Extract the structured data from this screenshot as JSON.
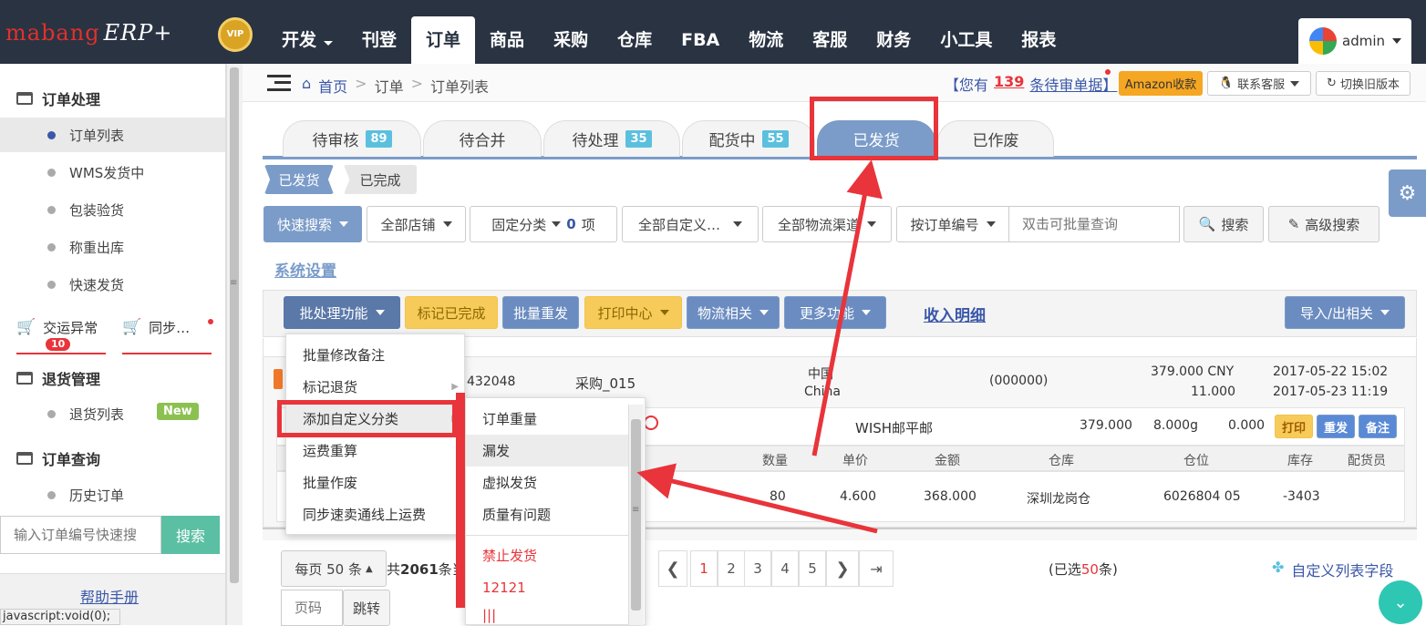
{
  "brand": {
    "logo": "mabang",
    "logo2": "ERP+",
    "vip": "VIP"
  },
  "nav": [
    "开发",
    "刊登",
    "订单",
    "商品",
    "采购",
    "仓库",
    "FBA",
    "物流",
    "客服",
    "财务",
    "小工具",
    "报表"
  ],
  "nav_dropdown": "开发",
  "nav_active": "订单",
  "user": {
    "name": "admin"
  },
  "sidebar": {
    "order_handling": "订单处理",
    "items": [
      "订单列表",
      "WMS发货中",
      "包装验货",
      "称重出库",
      "快速发货"
    ],
    "exception": "交运异常",
    "exception_badge": "10",
    "sync": "同步…",
    "returns": "退货管理",
    "return_list": "退货列表",
    "new_badge": "New",
    "query": "订单查询",
    "history": "历史订单",
    "search_placeholder": "输入订单编号快速搜",
    "search_button": "搜索",
    "help": "帮助手册",
    "status": "javascript:void(0);"
  },
  "breadcrumb": {
    "home": "首页",
    "b1": "订单",
    "b2": "订单列表"
  },
  "pending": {
    "pre": "【您有",
    "count": "139",
    "post": "条待审单据】"
  },
  "header_buttons": {
    "amazon": "Amazon收款",
    "contact": "联系客服",
    "switch": "切换旧版本"
  },
  "tabs": [
    {
      "label": "待审核",
      "count": "89"
    },
    {
      "label": "待合并",
      "count": ""
    },
    {
      "label": "待处理",
      "count": "35"
    },
    {
      "label": "配货中",
      "count": "55"
    },
    {
      "label": "已发货",
      "count": ""
    },
    {
      "label": "已作废",
      "count": ""
    }
  ],
  "subtabs": [
    "已发货",
    "已完成"
  ],
  "filters": {
    "quick": "快速搜索",
    "store": "全部店铺",
    "fixed": "固定分类",
    "fixed_count": "0",
    "fixed_unit": "项",
    "custom": "全部自定义…",
    "logistics": "全部物流渠道",
    "by_order": "按订单编号",
    "batch_placeholder": "双击可批量查询",
    "search": "搜索",
    "adv": "高级搜索"
  },
  "system_settings": "系统设置",
  "toolbar": {
    "batch": "批处理功能",
    "mark_done": "标记已完成",
    "batch_resend": "批量重发",
    "print": "打印中心",
    "logistics": "物流相关",
    "more": "更多功能",
    "income": "收入明细",
    "import": "导入/出相关"
  },
  "batch_menu": [
    "批量修改备注",
    "标记退货",
    "添加自定义分类",
    "运费重算",
    "批量作废",
    "同步速卖通线上运费"
  ],
  "sub_menu": [
    "订单重量",
    "漏发",
    "虚拟发货",
    "质量有问题"
  ],
  "sub_menu_red": [
    "禁止发货",
    "12121",
    "|||"
  ],
  "order": {
    "num_frag": "432048",
    "sku": "采购_015",
    "country": "中国",
    "country_en": "China",
    "phone": "(000000)",
    "amount": "379.000 CNY",
    "amount2": "11.000",
    "date1": "2017-05-22 15:02",
    "date2": "2017-05-23 11:19",
    "channel": "WISH邮平邮",
    "price": "379.000",
    "weight": "8.000g",
    "fee": "0.000",
    "act_print": "打印",
    "act_resend": "重发",
    "act_note": "备注"
  },
  "detail_headers": [
    "数量",
    "单价",
    "金额",
    "仓库",
    "仓位",
    "库存",
    "配货员"
  ],
  "detail_row": [
    "80",
    "4.600",
    "368.000",
    "深圳龙岗仓",
    "6026804 05",
    "-3403",
    ""
  ],
  "footer": {
    "per_page": "每页 50 条",
    "total_pre": "共",
    "total": "2061",
    "total_post": "条当",
    "pages": [
      "1",
      "2",
      "3",
      "4",
      "5"
    ],
    "selected_pre": "(已选",
    "selected": "50",
    "selected_post": "条)",
    "custom_cols": "自定义列表字段",
    "page_placeholder": "页码",
    "jump": "跳转"
  }
}
